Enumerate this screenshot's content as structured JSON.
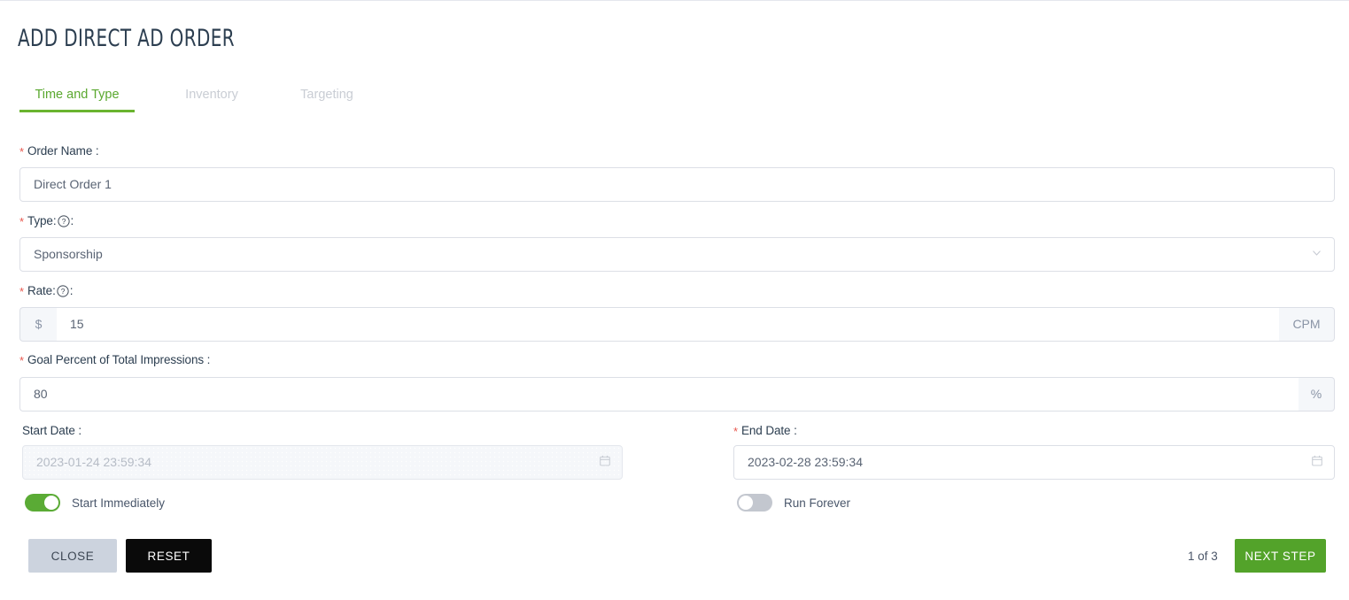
{
  "header": {
    "title": "ADD DIRECT AD ORDER"
  },
  "tabs": [
    {
      "label": "Time and Type",
      "active": true
    },
    {
      "label": "Inventory",
      "active": false
    },
    {
      "label": "Targeting",
      "active": false
    }
  ],
  "form": {
    "order_name": {
      "label": "Order Name :",
      "required": true,
      "value": "Direct Order 1"
    },
    "type": {
      "label_prefix": "Type:",
      "label_suffix": ":",
      "required": true,
      "has_help": true,
      "value": "Sponsorship",
      "chevron": "chevron-down-icon"
    },
    "rate": {
      "label_prefix": "Rate:",
      "label_suffix": ":",
      "required": true,
      "has_help": true,
      "prefix_addon": "$",
      "value": "15",
      "suffix_addon": "CPM"
    },
    "goal_percent": {
      "label": "Goal Percent of Total Impressions :",
      "required": true,
      "value": "80",
      "suffix_addon": "%"
    },
    "start_date": {
      "label": "Start Date :",
      "required": false,
      "value": "2023-01-24 23:59:34",
      "disabled": true
    },
    "end_date": {
      "label": "End Date :",
      "required": true,
      "value": "2023-02-28 23:59:34",
      "disabled": false
    },
    "start_immediately": {
      "label": "Start Immediately",
      "on": true
    },
    "run_forever": {
      "label": "Run Forever",
      "on": false
    }
  },
  "footer": {
    "close_label": "CLOSE",
    "reset_label": "RESET",
    "step_text": "1 of 3",
    "next_label": "NEXT STEP"
  },
  "colors": {
    "accent_green": "#53a32a",
    "tab_active": "#5aa82f",
    "required_red": "#e8584f",
    "reset_black": "#0a0a0a",
    "close_grey": "#ccd3de"
  }
}
